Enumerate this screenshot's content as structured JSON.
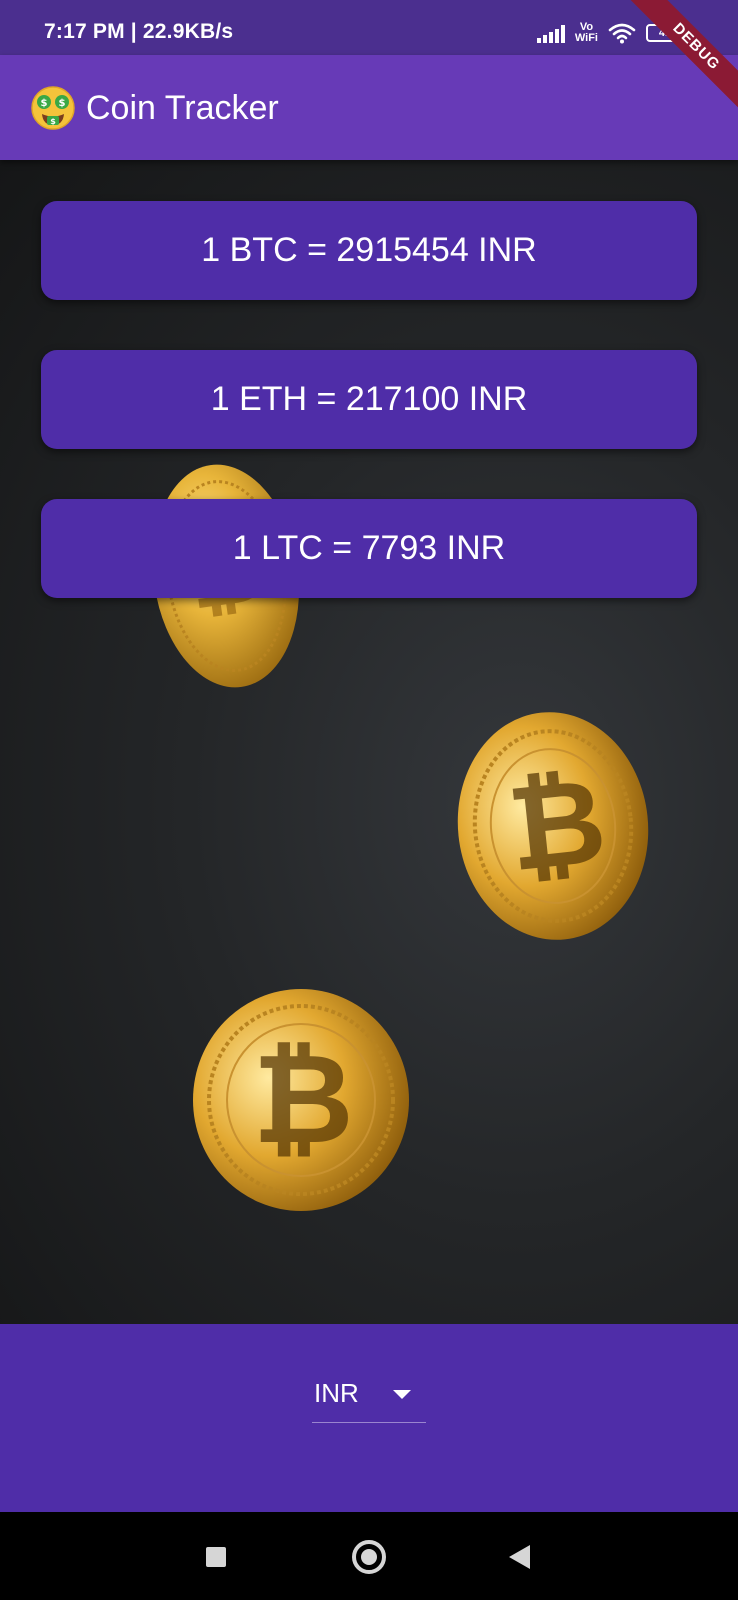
{
  "status_bar": {
    "time": "7:17 PM | 22.9KB/s",
    "vo_label": "Vo",
    "wifi_label": "WiFi",
    "battery_level": "41"
  },
  "debug_banner": {
    "label": "DEBUG"
  },
  "app_bar": {
    "title": "Coin Tracker",
    "icon": "money-mouth-face-emoji"
  },
  "rates": [
    {
      "text": "1 BTC = 2915454 INR"
    },
    {
      "text": "1 ETH = 217100 INR"
    },
    {
      "text": "1 LTC = 7793 INR"
    }
  ],
  "currency_selector": {
    "selected": "INR"
  },
  "nav_bar": {
    "icons": [
      "recent-apps-icon",
      "home-icon",
      "back-icon"
    ]
  },
  "colors": {
    "app_bar": "#673ab7",
    "card": "#4f2da8",
    "status_bar": "#4b2f8f",
    "debug_banner": "#8b1a34"
  }
}
